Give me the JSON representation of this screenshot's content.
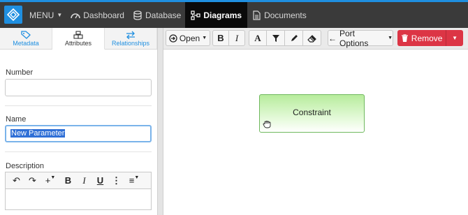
{
  "topbar": {
    "menu_label": "MENU",
    "nav": [
      {
        "label": "Dashboard",
        "icon": "dashboard-icon"
      },
      {
        "label": "Database",
        "icon": "database-icon"
      },
      {
        "label": "Diagrams",
        "icon": "diagram-icon",
        "active": true
      },
      {
        "label": "Documents",
        "icon": "document-icon"
      }
    ],
    "accent_color": "#1f8fe0"
  },
  "left_panel": {
    "tabs": [
      {
        "label": "Metadata",
        "icon": "tag-icon"
      },
      {
        "label": "Attributes",
        "icon": "cubes-icon",
        "active": true
      },
      {
        "label": "Relationships",
        "icon": "exchange-icon"
      }
    ],
    "fields": {
      "number_label": "Number",
      "number_value": "",
      "name_label": "Name",
      "name_value": "New Parameter",
      "description_label": "Description"
    },
    "rte_buttons": [
      "↶",
      "↷",
      "+",
      "B",
      "I",
      "U",
      "⋮",
      "≡"
    ]
  },
  "diagram_toolbar": {
    "open_label": "Open",
    "bold": "B",
    "italic": "I",
    "font": "A",
    "port_options_label": "Port Options",
    "remove_label": "Remove",
    "remove_color": "#dc3545"
  },
  "canvas": {
    "node_label": "Constraint"
  }
}
